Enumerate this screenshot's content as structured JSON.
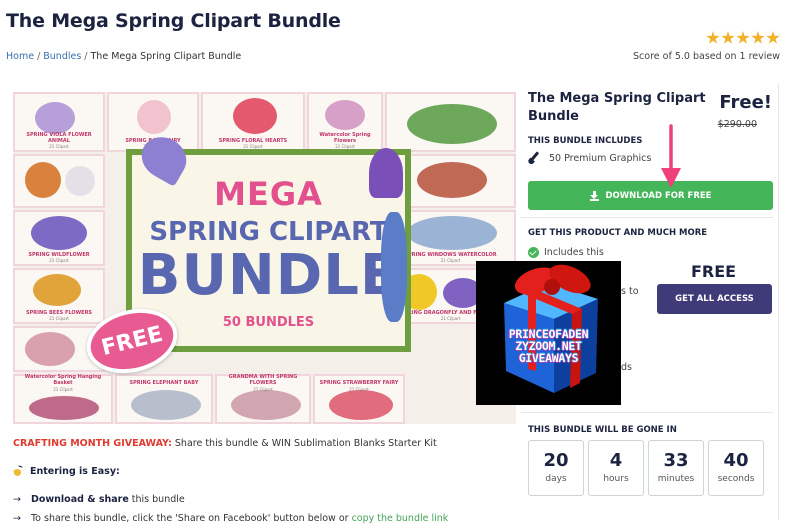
{
  "page_title": "The Mega Spring Clipart Bundle",
  "breadcrumb": {
    "home": "Home",
    "bundles": "Bundles",
    "current": "The Mega Spring Clipart Bundle",
    "separator": "/"
  },
  "rating": {
    "stars": 5,
    "max_stars": 5,
    "score_text": "Score of 5.0 based on 1 review"
  },
  "product_image": {
    "headline_1": "MEGA",
    "headline_2": "SPRING CLIPART",
    "headline_3": "BUNDLE",
    "headline_4": "50 BUNDLES",
    "badge": "FREE",
    "tiles": [
      {
        "label": "SPRING VIOLA FLOWER ANIMAL",
        "sub": "21 Clipart"
      },
      {
        "label": "SPRING BABY FAIRY",
        "sub": "21 Clipart"
      },
      {
        "label": "SPRING FLORAL HEARTS",
        "sub": "21 Clipart"
      },
      {
        "label": "Watercolor Spring Flowers",
        "sub": "21 Clipart"
      },
      {
        "label": "SPRING WILDFLOWER",
        "sub": "21 Clipart"
      },
      {
        "label": "SPRING WINDOWS WATERCOLOR",
        "sub": "21 Clipart"
      },
      {
        "label": "SPRING BEES FLOWERS",
        "sub": "21 Clipart"
      },
      {
        "label": "SPRING DRAGONFLY AND FLOWERS",
        "sub": "21 Clipart"
      },
      {
        "label": "Watercolor Spring Hanging Basket",
        "sub": "21 Clipart"
      },
      {
        "label": "SPRING ELEPHANT BABY",
        "sub": "21 Clipart"
      },
      {
        "label": "GRANDMA WITH SPRING FLOWERS",
        "sub": "21 Clipart"
      },
      {
        "label": "SPRING STRAWBERRY FAIRY",
        "sub": "21 Clipart"
      }
    ]
  },
  "panel": {
    "name": "The Mega Spring Clipart Bundle",
    "price": "Free!",
    "old_price": "$290.00",
    "includes_heading": "THIS BUNDLE INCLUDES",
    "graphics": "50 Premium Graphics",
    "download_label": "DOWNLOAD FOR FREE",
    "get_heading": "GET THIS PRODUCT AND MUCH MORE",
    "includes_this": "Includes this",
    "partial_1": "s to",
    "partial_2": "ds",
    "free_label": "FREE",
    "access_label": "GET ALL ACCESS",
    "gone_heading": "THIS BUNDLE WILL BE GONE IN",
    "countdown": [
      {
        "value": "20",
        "unit": "days"
      },
      {
        "value": "4",
        "unit": "hours"
      },
      {
        "value": "33",
        "unit": "minutes"
      },
      {
        "value": "40",
        "unit": "seconds"
      }
    ]
  },
  "gift_overlay": {
    "line_1": "PRINCEOFADEN",
    "line_2": "ZYZOOM.NET",
    "line_3": "GIVEAWAYS"
  },
  "content": {
    "giveaway_label": "CRAFTING MONTH GIVEAWAY:",
    "giveaway_text": " Share this bundle & WIN Sublimation Blanks Starter Kit",
    "easy_label": "Entering is Easy:",
    "step1_bold": "Download & share",
    "step1_rest": " this bundle",
    "step2_text": "To share this bundle, click the 'Share on Facebook' button below or ",
    "step2_link": "copy the bundle link",
    "arrow": "→"
  },
  "colors": {
    "download_green": "#45b55a",
    "access_purple": "#3f3a78",
    "star_gold": "#f3b02a",
    "giveaway_red": "#e03a2f",
    "arrow_pink": "#f0407a"
  }
}
